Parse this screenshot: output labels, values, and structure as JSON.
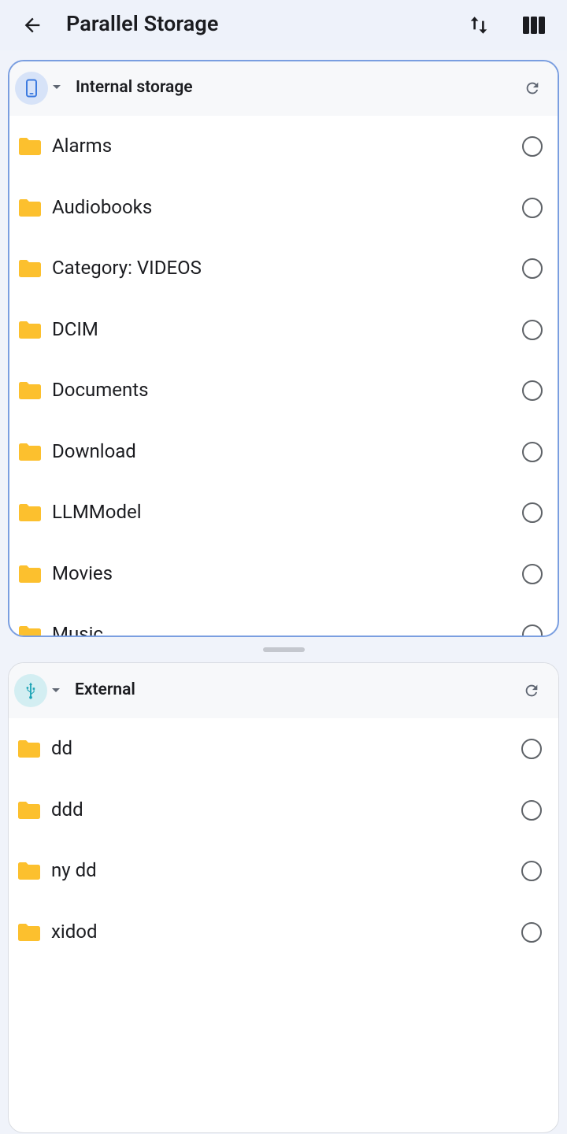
{
  "app": {
    "title": "Parallel Storage",
    "accent": "#7a9ee0",
    "folder_color": "#fcc02e"
  },
  "toolbar": {
    "back_icon": "arrow-left-icon",
    "sort_icon": "swap-vertical-icon",
    "columns_icon": "view-columns-icon"
  },
  "panes": [
    {
      "volume_name": "Internal storage",
      "volume_icon": "phone-icon",
      "volume_icon_bg": "#d7e3f8",
      "volume_icon_color": "#3d7be0",
      "active": true,
      "items": [
        {
          "name": "Alarms"
        },
        {
          "name": "Audiobooks"
        },
        {
          "name": "Category: VIDEOS"
        },
        {
          "name": "DCIM"
        },
        {
          "name": "Documents"
        },
        {
          "name": "Download"
        },
        {
          "name": "LLMModel"
        },
        {
          "name": "Movies"
        },
        {
          "name": "Music"
        }
      ]
    },
    {
      "volume_name": "External",
      "volume_icon": "usb-icon",
      "volume_icon_bg": "#d3eef2",
      "volume_icon_color": "#1aa3b5",
      "active": false,
      "items": [
        {
          "name": "dd"
        },
        {
          "name": "ddd"
        },
        {
          "name": "ny dd"
        },
        {
          "name": "xidod"
        }
      ]
    }
  ]
}
